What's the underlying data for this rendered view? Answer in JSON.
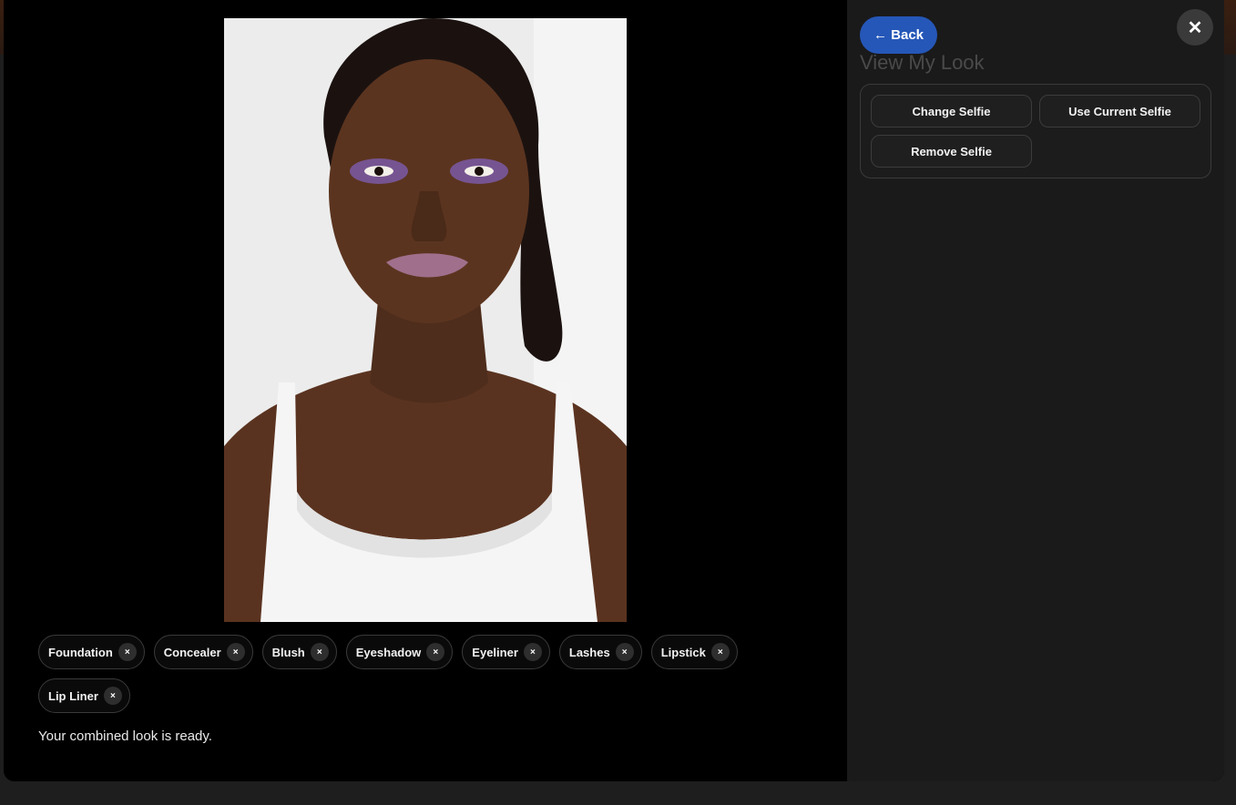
{
  "panel": {
    "back_label": "← Back",
    "title": "View My Look",
    "close_label": "✕",
    "actions": {
      "change_selfie": "Change Selfie",
      "use_current_selfie": "Use Current Selfie",
      "remove_selfie": "Remove Selfie"
    }
  },
  "products": [
    {
      "label": "Foundation",
      "remove": "×"
    },
    {
      "label": "Concealer",
      "remove": "×"
    },
    {
      "label": "Blush",
      "remove": "×"
    },
    {
      "label": "Eyeshadow",
      "remove": "×"
    },
    {
      "label": "Eyeliner",
      "remove": "×"
    },
    {
      "label": "Lashes",
      "remove": "×"
    },
    {
      "label": "Lipstick",
      "remove": "×"
    },
    {
      "label": "Lip Liner",
      "remove": "×"
    }
  ],
  "status": "Your combined look is ready.",
  "colors": {
    "accent": "#2557b8",
    "eyeshadow": "#7b5aa6",
    "lipstick": "#a06f8c"
  }
}
